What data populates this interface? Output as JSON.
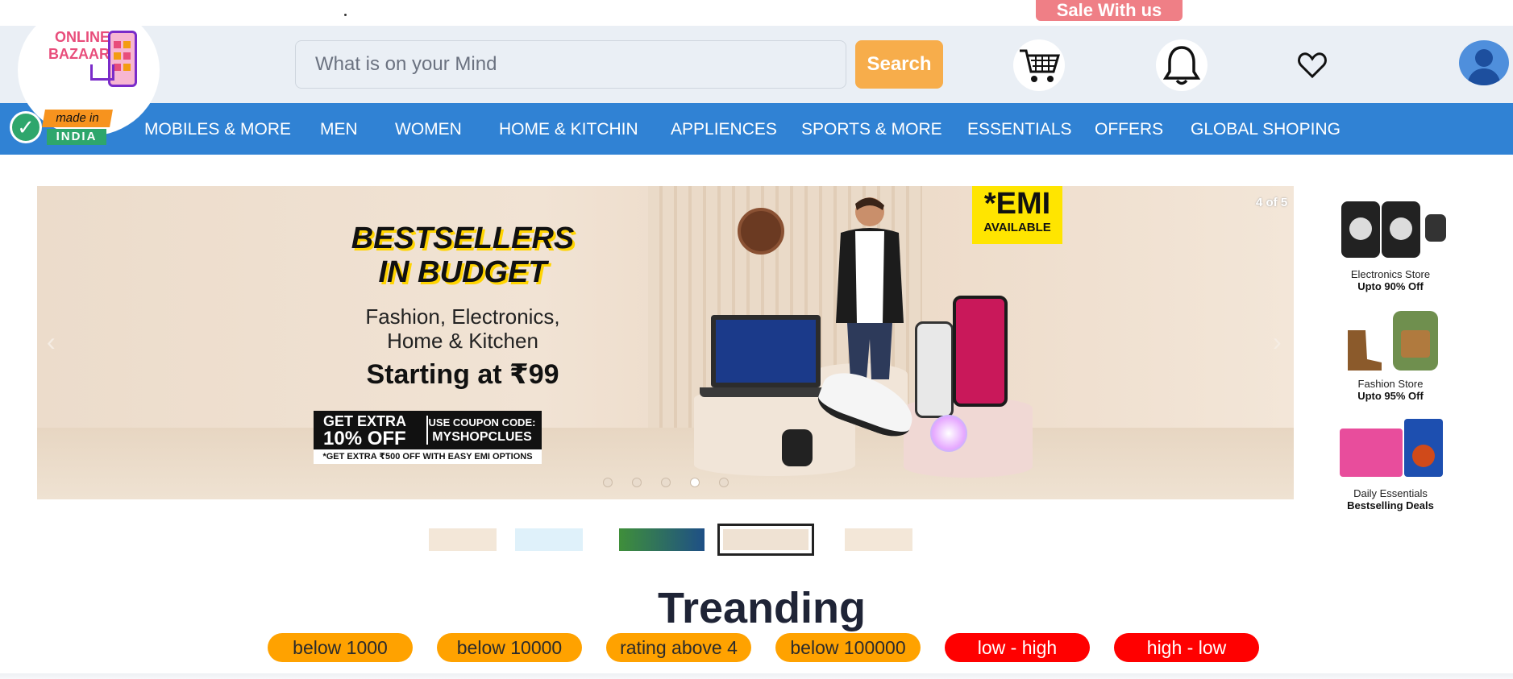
{
  "top": {
    "sale_label": "Sale With us"
  },
  "logo": {
    "line1": "ONLINE",
    "line2": "BAZAAR",
    "made_line1": "made in",
    "made_line2": "INDIA"
  },
  "search": {
    "placeholder": "What is on your Mind",
    "button_label": "Search"
  },
  "nav": {
    "items": [
      "MOBILES & MORE",
      "MEN",
      "WOMEN",
      "HOME & KITCHIN",
      "APPLIENCES",
      "SPORTS & MORE",
      "ESSENTIALS",
      "OFFERS",
      "GLOBAL SHOPING"
    ]
  },
  "banner": {
    "headline1": "BESTSELLERS",
    "headline2": "IN BUDGET",
    "sub_line1": "Fashion, Electronics,",
    "sub_line2": "Home & Kitchen",
    "price_line": "Starting at ₹99",
    "coupon_left1": "GET EXTRA",
    "coupon_left2": "10% OFF",
    "coupon_right1": "USE COUPON CODE:",
    "coupon_right2": "MYSHOPCLUES",
    "coupon_note": "*GET EXTRA ₹500 OFF WITH EASY EMI OPTIONS",
    "emi_line1": "*EMI",
    "emi_line2": "AVAILABLE",
    "counter": "4 of 5",
    "prev_arrow": "‹",
    "next_arrow": "›",
    "active_slide": 4,
    "slide_count": 5
  },
  "side_stores": [
    {
      "name": "Electronics Store",
      "deal": "Upto 90% Off",
      "icon": "speaker-watch-image"
    },
    {
      "name": "Fashion Store",
      "deal": "Upto 95% Off",
      "icon": "boots-backpack-image"
    },
    {
      "name": "Daily Essentials",
      "deal": "Bestselling Deals",
      "icon": "groceries-image"
    }
  ],
  "trending": {
    "title": "Treanding",
    "filters": [
      "below 1000",
      "below 10000",
      "rating above 4",
      "below 100000",
      "low - high",
      "high - low"
    ]
  },
  "colors": {
    "nav_bg": "#3082d4",
    "header_bg": "#eaeff5",
    "search_btn": "#f7ad4b",
    "sale_btn": "#ef7f86",
    "filter_orange": "#ffa200",
    "filter_red": "#ff0000"
  }
}
